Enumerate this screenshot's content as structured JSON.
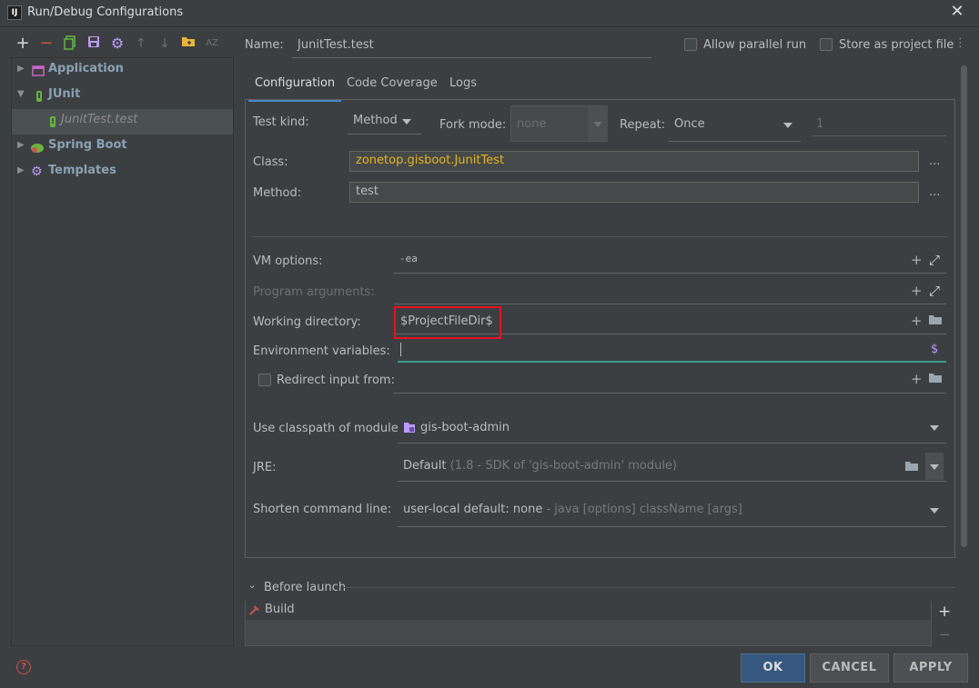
{
  "window": {
    "title": "Run/Debug Configurations",
    "app_icon_text": "IJ"
  },
  "toolbar": {
    "icons": [
      "add-icon",
      "remove-icon",
      "copy-icon",
      "save-icon",
      "settings-icon",
      "move-up-icon",
      "move-down-icon",
      "folder-icon",
      "sort-az-icon"
    ],
    "sort_glyph": "AZ"
  },
  "tree": {
    "items": [
      {
        "label": "Application",
        "expanded": false
      },
      {
        "label": "JUnit",
        "expanded": true,
        "children": [
          {
            "label": "JunitTest.test",
            "selected": true
          }
        ]
      },
      {
        "label": "Spring Boot",
        "expanded": false
      },
      {
        "label": "Templates",
        "expanded": false
      }
    ]
  },
  "header": {
    "name_label": "Name:",
    "name_value": "JunitTest.test",
    "allow_parallel_label": "Allow parallel run",
    "store_project_label": "Store as project file"
  },
  "tabs": [
    {
      "label": "Configuration",
      "active": true
    },
    {
      "label": "Code Coverage",
      "active": false
    },
    {
      "label": "Logs",
      "active": false
    }
  ],
  "config": {
    "test_kind_label": "Test kind:",
    "test_kind_value": "Method",
    "fork_mode_label": "Fork mode:",
    "fork_mode_value": "none",
    "repeat_label": "Repeat:",
    "repeat_value": "Once",
    "repeat_count": "1",
    "class_label": "Class:",
    "class_value": "zonetop.gisboot.JunitTest",
    "method_label": "Method:",
    "method_value": "test",
    "vm_options_label": "VM options:",
    "vm_options_value": "-ea",
    "program_args_label": "Program arguments:",
    "working_dir_label": "Working directory:",
    "working_dir_value": "$ProjectFileDir$",
    "env_vars_label": "Environment variables:",
    "env_vars_value": "",
    "redirect_label": "Redirect input from:",
    "classpath_label": "Use classpath of module:",
    "classpath_value": "gis-boot-admin",
    "jre_label": "JRE:",
    "jre_value": "Default",
    "jre_detail": "(1.8 - SDK of 'gis-boot-admin' module)",
    "shorten_label": "Shorten command line:",
    "shorten_value": "user-local default: none",
    "shorten_detail": "- java [options] className [args]",
    "ellipsis": "...",
    "dollar": "$"
  },
  "before_launch": {
    "label": "Before launch",
    "items": [
      {
        "label": "Build"
      }
    ]
  },
  "buttons": {
    "ok": "OK",
    "cancel": "CANCEL",
    "apply": "APPLY"
  },
  "colors": {
    "highlight_box": "#e81123",
    "accent": "#4a88c7",
    "class_value": "#e6b422",
    "env_focus": "#3d9c91"
  }
}
